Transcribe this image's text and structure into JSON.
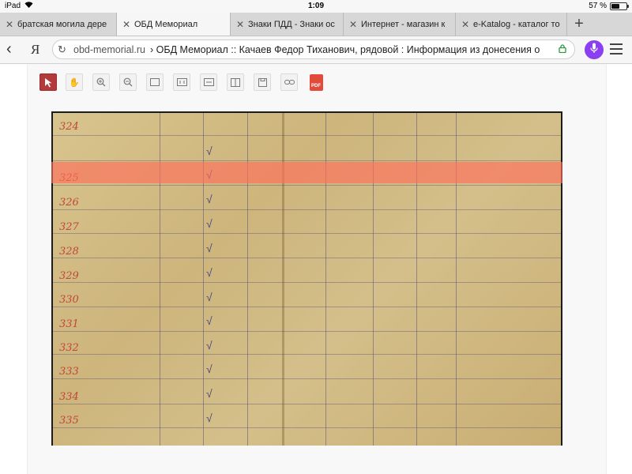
{
  "status_bar": {
    "device": "iPad",
    "time": "1:09",
    "battery": "57 %",
    "battery_level": 0.57
  },
  "tabs": [
    {
      "label": "братская могила дере",
      "active": false
    },
    {
      "label": "ОБД Мемориал",
      "active": true
    },
    {
      "label": "Знаки ПДД - Знаки ос",
      "active": false
    },
    {
      "label": "Интернет - магазин к",
      "active": false
    },
    {
      "label": "e-Katalog - каталог то",
      "active": false
    }
  ],
  "new_tab": "+",
  "toolbar": {
    "back": "‹",
    "yandex": "Я",
    "domain": "obd-memorial.ru",
    "page_title": "› ОБД Мемориал :: Качаев Федор Тиханович, рядовой : Информация из донесения о",
    "accent": "#8a3ff0"
  },
  "viewer": {
    "pdf_label": "PDF"
  },
  "document": {
    "row_numbers": [
      "324",
      "325",
      "326",
      "327",
      "328",
      "329",
      "330",
      "331",
      "332",
      "333",
      "334",
      "335"
    ],
    "highlight_color": "#ff6e5a"
  }
}
